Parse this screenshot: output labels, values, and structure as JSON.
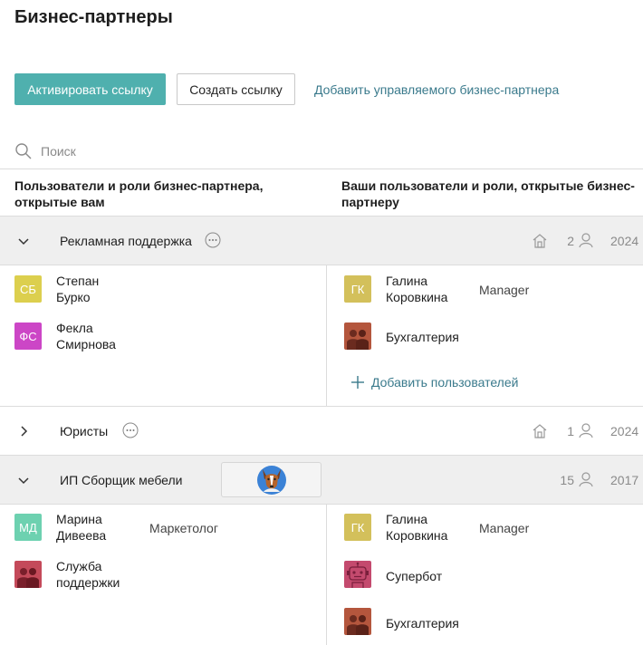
{
  "page": {
    "title": "Бизнес-партнеры"
  },
  "toolbar": {
    "activate_label": "Активировать ссылку",
    "create_label": "Создать ссылку",
    "add_partner_label": "Добавить управляемого бизнес-партнера"
  },
  "search": {
    "placeholder": "Поиск",
    "icon": "search-icon"
  },
  "columns": {
    "left": "Пользователи и роли бизнес-партнера, открытые вам",
    "right": "Ваши пользователи и роли, открытые бизнес-партнеру"
  },
  "groups": [
    {
      "name": "Рекламная поддержка",
      "expanded": true,
      "count": "2",
      "year": "2024",
      "left_users": [
        {
          "initials": "СБ",
          "name_line1": "Степан",
          "name_line2": "Бурко",
          "role": "",
          "color": "#dccf4e"
        },
        {
          "initials": "ФС",
          "name_line1": "Фекла",
          "name_line2": "Смирнова",
          "role": "",
          "color": "#cc46c6"
        }
      ],
      "right_users": [
        {
          "initials": "ГК",
          "name_line1": "Галина",
          "name_line2": "Коровкина",
          "role": "Manager",
          "color": "#d3c05b"
        },
        {
          "name": "Бухгалтерия",
          "icon": "group-icon",
          "color": "#b4563d"
        }
      ],
      "add_users_label": "Добавить пользователей"
    },
    {
      "name": "Юристы",
      "expanded": false,
      "count": "1",
      "year": "2024"
    },
    {
      "name": "ИП Сборщик мебели",
      "expanded": true,
      "count": "15",
      "year": "2017",
      "logo": "dog-logo",
      "left_users": [
        {
          "initials": "МД",
          "name_line1": "Марина",
          "name_line2": "Дивеева",
          "role": "Маркетолог",
          "color": "#6dd1b0"
        },
        {
          "name_line1": "Служба",
          "name_line2": "поддержки",
          "icon": "group-icon",
          "color": "#c44a5a"
        }
      ],
      "right_users": [
        {
          "initials": "ГК",
          "name_line1": "Галина",
          "name_line2": "Коровкина",
          "role": "Manager",
          "color": "#d3c05b"
        },
        {
          "name": "Супербот",
          "icon": "robot-icon",
          "color": "#c44a6e"
        },
        {
          "name": "Бухгалтерия",
          "icon": "group-icon",
          "color": "#b4563d"
        }
      ]
    }
  ]
}
